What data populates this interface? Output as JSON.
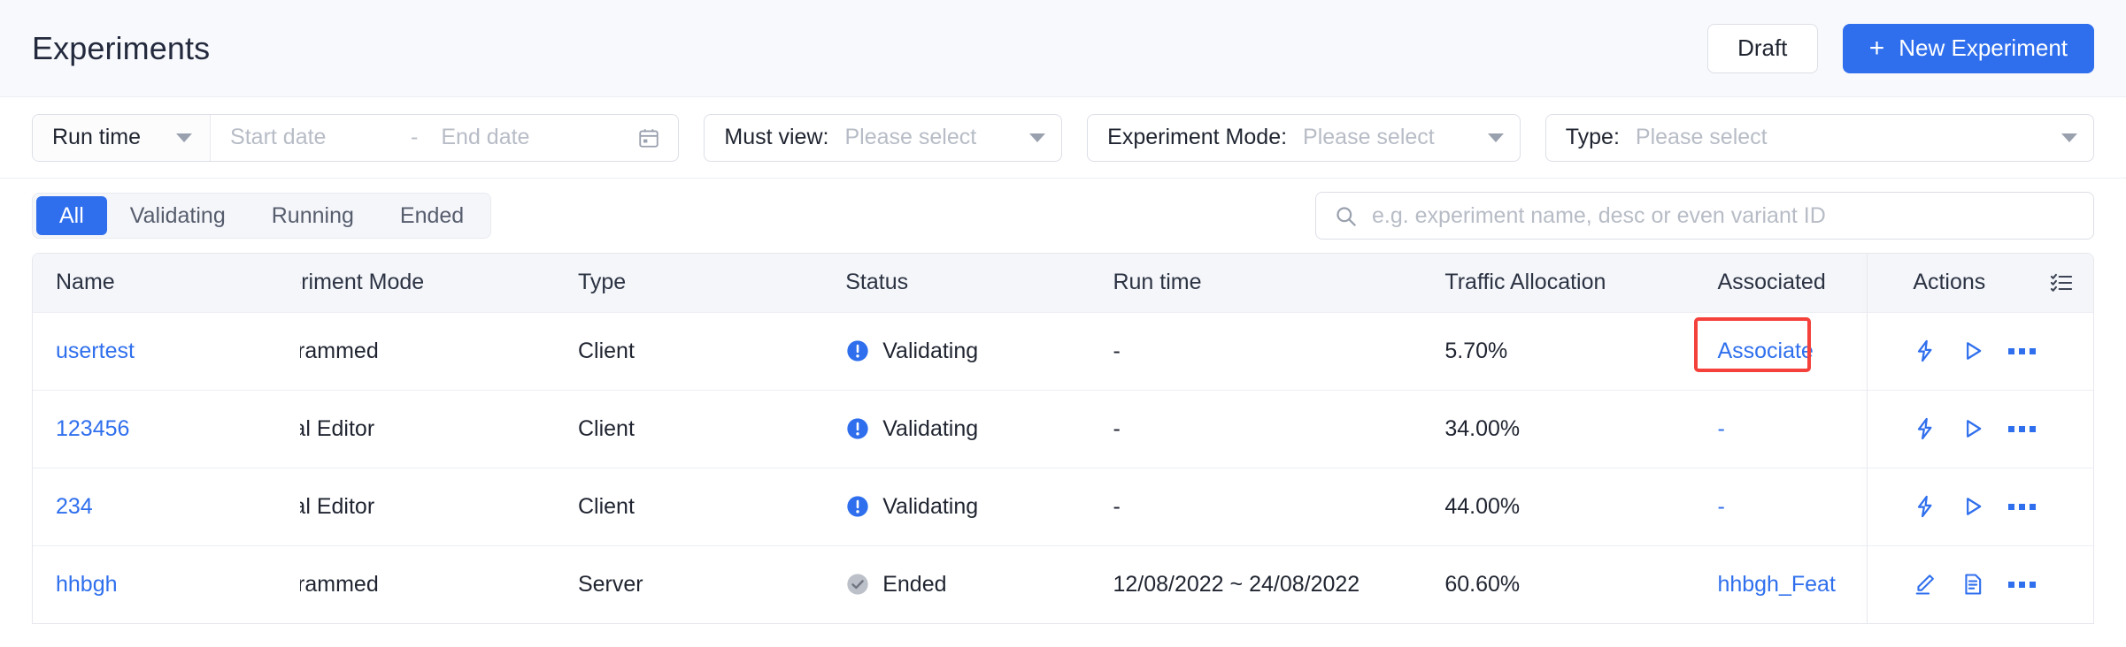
{
  "header": {
    "title": "Experiments",
    "draft_label": "Draft",
    "new_experiment_label": "New Experiment",
    "plus_glyph": "+"
  },
  "filters": {
    "run_time": {
      "select_label": "Run time",
      "start_placeholder": "Start date",
      "separator": "-",
      "end_placeholder": "End date",
      "calendar_icon": "calendar-icon"
    },
    "must_view": {
      "label": "Must view:",
      "value": "Please select"
    },
    "experiment_mode": {
      "label": "Experiment Mode:",
      "value": "Please select"
    },
    "type": {
      "label": "Type:",
      "value": "Please select"
    }
  },
  "toolbar": {
    "tabs": [
      {
        "label": "All",
        "active": true
      },
      {
        "label": "Validating",
        "active": false
      },
      {
        "label": "Running",
        "active": false
      },
      {
        "label": "Ended",
        "active": false
      }
    ],
    "search": {
      "placeholder": "e.g. experiment name, desc or even variant ID",
      "icon": "search-icon"
    }
  },
  "table": {
    "columns": [
      {
        "key": "name",
        "label": "Name"
      },
      {
        "key": "mode",
        "label": "Experiment Mode",
        "clipped_label": "periment Mode"
      },
      {
        "key": "type",
        "label": "Type"
      },
      {
        "key": "status",
        "label": "Status"
      },
      {
        "key": "runtime",
        "label": "Run time"
      },
      {
        "key": "traffic",
        "label": "Traffic Allocation"
      },
      {
        "key": "associated",
        "label": "Associated"
      },
      {
        "key": "actions",
        "label": "Actions"
      }
    ],
    "column_settings_icon": "column-settings-icon",
    "rows": [
      {
        "name": "usertest",
        "mode": "Programmed",
        "mode_clipped": "ogrammed",
        "type": "Client",
        "status": "Validating",
        "status_icon": "info-circle-icon",
        "runtime": "-",
        "traffic": "5.70%",
        "associated": "Associate",
        "associated_highlighted": true,
        "actions": [
          "bolt-icon",
          "play-icon",
          "more-icon"
        ]
      },
      {
        "name": "123456",
        "mode": "Visual Editor",
        "mode_clipped": "sual Editor",
        "type": "Client",
        "status": "Validating",
        "status_icon": "info-circle-icon",
        "runtime": "-",
        "traffic": "34.00%",
        "associated": "-",
        "associated_highlighted": false,
        "actions": [
          "bolt-icon",
          "play-icon",
          "more-icon"
        ]
      },
      {
        "name": "234",
        "mode": "Visual Editor",
        "mode_clipped": "sual Editor",
        "type": "Client",
        "status": "Validating",
        "status_icon": "info-circle-icon",
        "runtime": "-",
        "traffic": "44.00%",
        "associated": "-",
        "associated_highlighted": false,
        "actions": [
          "bolt-icon",
          "play-icon",
          "more-icon"
        ]
      },
      {
        "name": "hhbgh",
        "mode": "Programmed",
        "mode_clipped": "ogrammed",
        "type": "Server",
        "status": "Ended",
        "status_icon": "check-circle-icon",
        "runtime": "12/08/2022 ~ 24/08/2022",
        "traffic": "60.60%",
        "associated": "hhbgh_Feat",
        "associated_highlighted": false,
        "actions": [
          "edit-icon",
          "document-icon",
          "more-icon"
        ]
      }
    ]
  },
  "colors": {
    "accent": "#2f6fed",
    "highlight": "#f5413b",
    "status_validating": "#2f6fed",
    "status_ended": "#b9bdc6",
    "header_bg": "#f8f9fc",
    "table_header_bg": "#f4f6fa"
  }
}
